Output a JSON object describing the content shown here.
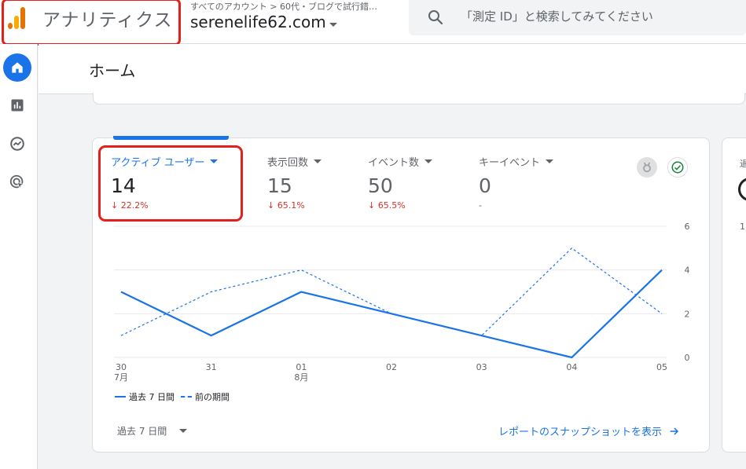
{
  "header": {
    "app_title": "アナリティクス",
    "account_path": "すべてのアカウント > 60代・ブログで試行錯…",
    "property_name": "serenelife62.com",
    "search_placeholder": "「測定 ID」と検索してみてください"
  },
  "nav": {
    "items": [
      "home-icon",
      "reports-icon",
      "explore-icon",
      "advertising-icon"
    ],
    "active": "home-icon"
  },
  "page": {
    "title": "ホーム"
  },
  "metrics": [
    {
      "label": "アクティブ ユーザー",
      "value": "14",
      "change": "↓ 22.2%"
    },
    {
      "label": "表示回数",
      "value": "15",
      "change": "↓ 65.1%"
    },
    {
      "label": "イベント数",
      "value": "50",
      "change": "↓ 65.5%"
    },
    {
      "label": "キーイベント",
      "value": "0",
      "change": "-"
    }
  ],
  "chart_data": {
    "type": "line",
    "categories": [
      "30\n7月",
      "31",
      "01\n8月",
      "02",
      "03",
      "04",
      "05"
    ],
    "series": [
      {
        "name": "過去 7 日間",
        "style": "solid",
        "values": [
          3,
          1,
          3,
          2,
          1,
          0,
          4
        ]
      },
      {
        "name": "前の期間",
        "style": "dashed",
        "values": [
          1,
          3,
          4,
          2,
          1,
          5,
          2
        ]
      }
    ],
    "ylim": [
      0,
      6
    ],
    "y_ticks": [
      "0",
      "2",
      "4",
      "6"
    ],
    "grid": true
  },
  "legend": {
    "current": "過去 7 日間",
    "previous": "前の期間"
  },
  "footer": {
    "range_label": "過去 7 日間",
    "report_link": "レポートのスナップショットを表示"
  },
  "side_card": {
    "text_1": "過",
    "text_2": "1"
  },
  "colors": {
    "accent": "#1a73e8",
    "negative": "#d93025",
    "highlight": "#e3201b"
  }
}
